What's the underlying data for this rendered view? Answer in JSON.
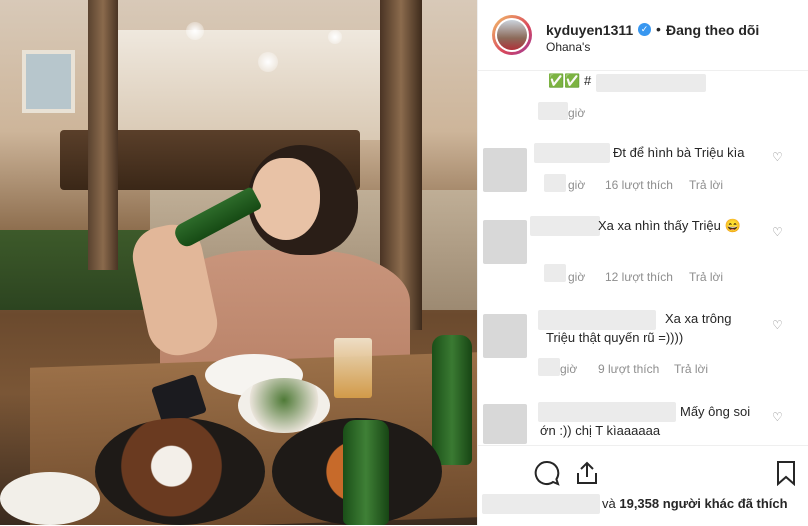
{
  "post": {
    "author": {
      "username": "kyduyen1311",
      "verified": true,
      "follow_status": "Đang theo dõi",
      "location": "Ohana's"
    },
    "caption": {
      "text_prefix": "✅✅ #",
      "time": "giờ"
    }
  },
  "comments": [
    {
      "text": "Đt để hình bà Triệu kìa",
      "time": "giờ",
      "likes": "16 lượt thích",
      "reply": "Trả lời"
    },
    {
      "text": "Xa xa nhìn thấy Triệu 😄",
      "emoji": "😄",
      "time": "giờ",
      "likes": "12 lượt thích",
      "reply": "Trả lời"
    },
    {
      "text_line1": "Xa xa trông",
      "text_line2": "Triệu thật quyến rũ =))))",
      "time": "giờ",
      "likes": "9 lượt thích",
      "reply": "Trả lời"
    },
    {
      "text_line1": "Mấy ông soi",
      "text_line2": "ớn :)) chị T kìaaaaaa"
    }
  ],
  "actions": {
    "likes_prefix": "và",
    "likes_count": "19,358",
    "likes_suffix": "người khác đã thích"
  },
  "colors": {
    "verified": "#3897f0",
    "muted": "#8e8e8e",
    "divider": "#efefef"
  },
  "icons": [
    "comment-icon",
    "share-icon",
    "bookmark-icon",
    "heart-icon",
    "verified-icon"
  ]
}
